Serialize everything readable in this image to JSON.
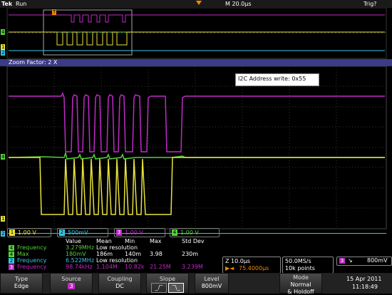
{
  "header": {
    "brand": "Tek",
    "status": "Run",
    "timebase": "M 20.0μs",
    "trigger_status": "Trig?"
  },
  "zoom_bar": {
    "label": "Zoom Factor: 2 X"
  },
  "annotation": {
    "text": "I2C Address write: 0x55"
  },
  "channel_markers": {
    "ch1": "1",
    "ch2": "2",
    "ch4": "4",
    "trigger_marker": "T"
  },
  "channel_scales": [
    {
      "num": "1",
      "value": "1.00 V",
      "color": "#e8e23a"
    },
    {
      "num": "2",
      "value": "500mV",
      "color": "#33c9e8"
    },
    {
      "num": "3",
      "value": "1.00 V",
      "color": "#c02ac8"
    },
    {
      "num": "4",
      "value": "1.00 V",
      "color": "#55d13a"
    }
  ],
  "measurements": {
    "headers": [
      "Value",
      "Mean",
      "Min",
      "Max",
      "Std Dev"
    ],
    "rows": [
      {
        "ch": "4",
        "name": "Frequency",
        "value": "3.279MHz",
        "mean": "Low resolution",
        "min": "",
        "max": "",
        "std": "",
        "color": "#55d13a"
      },
      {
        "ch": "4",
        "name": "Max",
        "value": "180mV",
        "mean": "186m",
        "min": "140m",
        "max": "3.98",
        "std": "230m",
        "color": "#55d13a"
      },
      {
        "ch": "2",
        "name": "Frequency",
        "value": "6.522MHz",
        "mean": "Low resolution",
        "min": "",
        "max": "",
        "std": "",
        "color": "#33c9e8"
      },
      {
        "ch": "3",
        "name": "Frequency",
        "value": "98.74kHz",
        "mean": "1.104M",
        "min": "10.82k",
        "max": "21.25M",
        "std": "3.239M",
        "color": "#c02ac8"
      }
    ]
  },
  "timebase_panel": {
    "zoom": "Z 10.0μs",
    "position": "75.4000μs",
    "sample_rate": "50.0MS/s",
    "record_length": "10k points"
  },
  "trigger_panel": {
    "channel": "3",
    "level": "800mV"
  },
  "datetime": {
    "date": "15 Apr 2011",
    "time": "11:18:49"
  },
  "buttons": {
    "type": {
      "title": "Type",
      "value": "Edge"
    },
    "source": {
      "title": "Source",
      "value": "3"
    },
    "coupling": {
      "title": "Coupling",
      "value": "DC"
    },
    "slope": {
      "title": "Slope"
    },
    "level": {
      "title": "Level",
      "value": "800mV"
    },
    "mode": {
      "title": "Mode",
      "value": "Normal",
      "value2": "& Holdoff"
    }
  },
  "colors": {
    "ch1": "#e8e23a",
    "ch2": "#33c9e8",
    "ch3": "#c02ac8",
    "ch4": "#55d13a",
    "trigger": "#f08a00"
  }
}
